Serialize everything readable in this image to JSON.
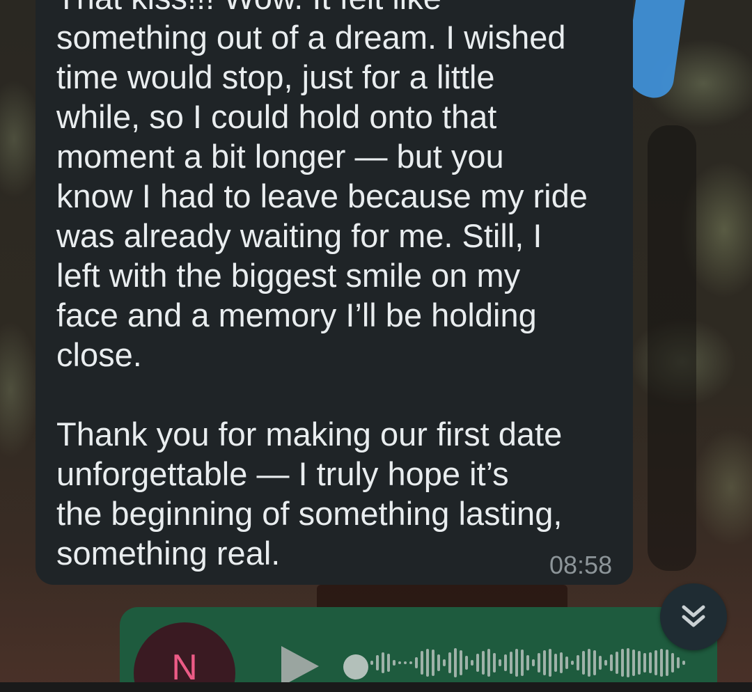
{
  "chat": {
    "incoming_message": {
      "text": "That kiss!!! Wow. It felt like\nsomething out of a dream. I wished\ntime would stop, just for a little\nwhile, so I could hold onto that\nmoment a bit longer — but you\nknow I had to leave because my ride\nwas already waiting for me. Still, I\nleft with the biggest smile on my\nface and a memory I’ll be holding\nclose.\n\nThank you for making our first date\nunforgettable — I truly hope it’s\nthe beginning of something lasting,\nsomething real.",
      "time": "08:58"
    },
    "scroll_button": {
      "icon": "double-chevron-down-icon"
    },
    "voice_message": {
      "avatar_initial": "N",
      "play_icon": "play-icon",
      "progress": 0,
      "colors": {
        "bubble": "#1e5b3e",
        "avatar_bg": "#3a1a22",
        "avatar_text": "#ec5b86",
        "wave": "#9fb2a9"
      }
    }
  },
  "colors": {
    "incoming_bubble": "#1f2427",
    "text": "#e9edef",
    "timestamp": "#8d9599",
    "scroll_button_bg": "#1f2c33"
  }
}
